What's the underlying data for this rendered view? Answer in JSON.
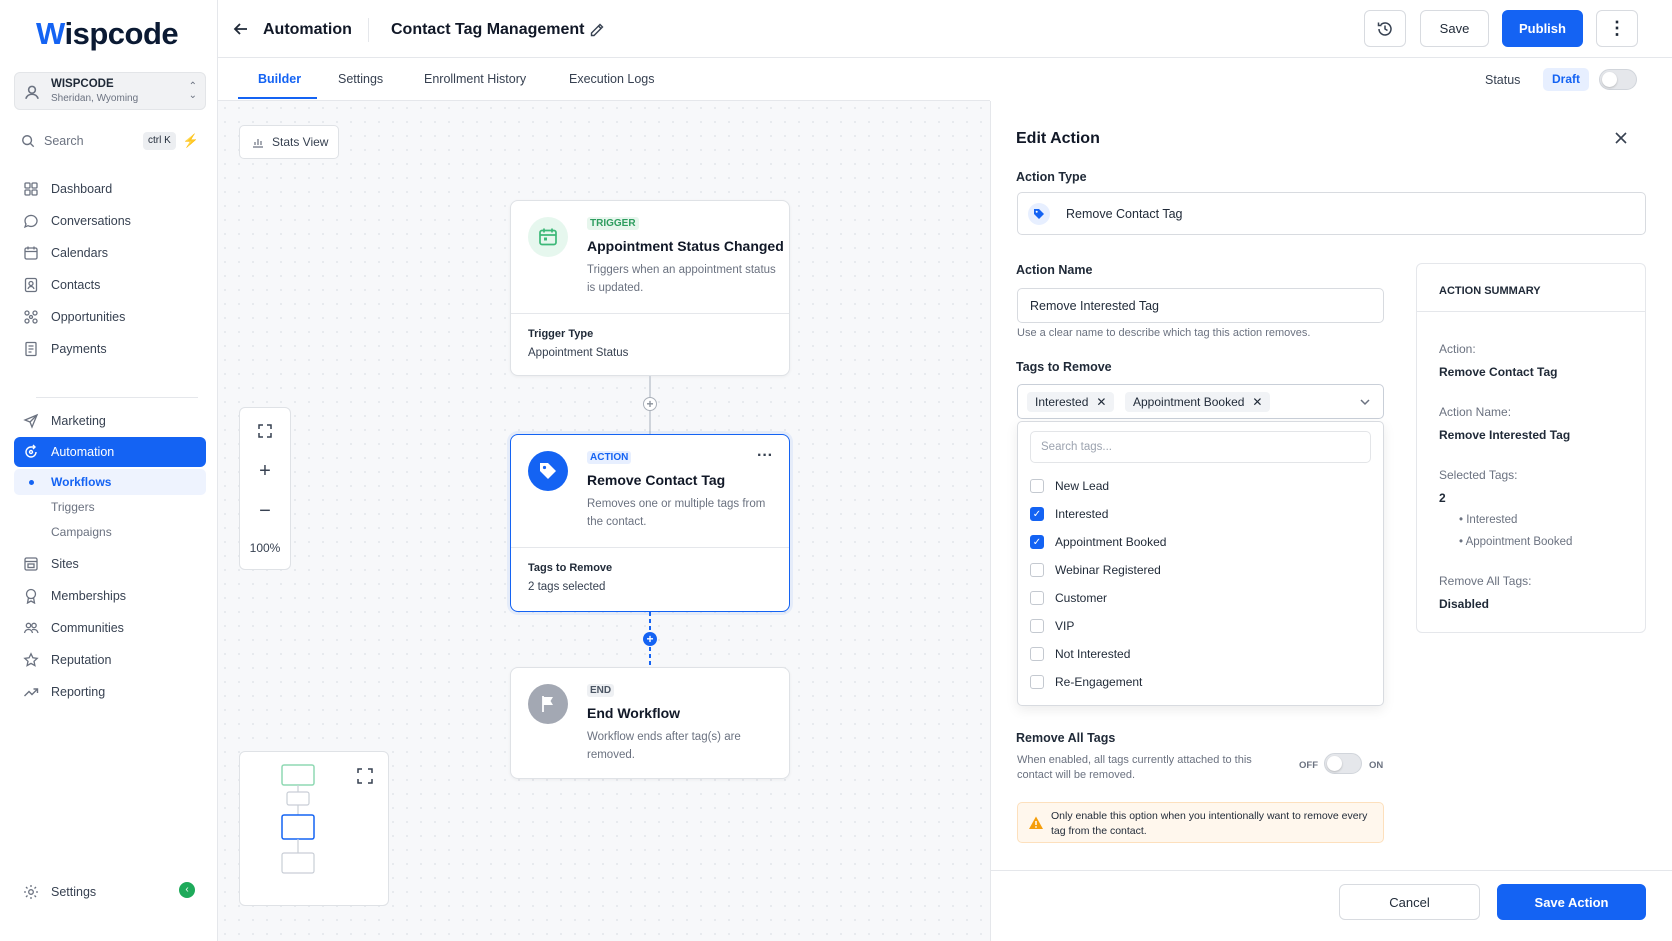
{
  "brand": {
    "logo_w": "W",
    "logo_rest": "ispcode"
  },
  "account": {
    "name": "WISPCODE",
    "location": "Sheridan, Wyoming"
  },
  "search": {
    "label": "Search",
    "shortcut": "ctrl K"
  },
  "sidebar": {
    "items": [
      {
        "label": "Dashboard",
        "icon": "grid-icon"
      },
      {
        "label": "Conversations",
        "icon": "chat-icon"
      },
      {
        "label": "Calendars",
        "icon": "calendar-icon"
      },
      {
        "label": "Contacts",
        "icon": "contacts-icon"
      },
      {
        "label": "Opportunities",
        "icon": "opportunities-icon"
      },
      {
        "label": "Payments",
        "icon": "payments-icon"
      },
      {
        "label": "Marketing",
        "icon": "send-icon"
      },
      {
        "label": "Automation",
        "icon": "automation-icon"
      },
      {
        "label": "Sites",
        "icon": "sites-icon"
      },
      {
        "label": "Memberships",
        "icon": "membership-icon"
      },
      {
        "label": "Communities",
        "icon": "communities-icon"
      },
      {
        "label": "Reputation",
        "icon": "star-icon"
      },
      {
        "label": "Reporting",
        "icon": "trend-icon"
      }
    ],
    "sub_items": [
      "Workflows",
      "Triggers",
      "Campaigns"
    ],
    "settings": "Settings"
  },
  "header": {
    "crumb": "Automation",
    "workflow_title": "Contact Tag Management",
    "save": "Save",
    "publish": "Publish"
  },
  "tabs": [
    "Builder",
    "Settings",
    "Enrollment History",
    "Execution Logs"
  ],
  "status": {
    "label": "Status",
    "value": "Draft"
  },
  "canvas": {
    "stats_view": "Stats View",
    "zoom": "100%",
    "trigger": {
      "tag": "TRIGGER",
      "title": "Appointment Status Changed",
      "desc": "Triggers when an appointment status is updated.",
      "foot_label": "Trigger Type",
      "foot_value": "Appointment Status"
    },
    "action": {
      "tag": "ACTION",
      "title": "Remove Contact Tag",
      "desc": "Removes one or multiple tags from the contact.",
      "foot_label": "Tags to Remove",
      "foot_value": "2 tags selected"
    },
    "end": {
      "tag": "END",
      "title": "End Workflow",
      "desc": "Workflow ends after tag(s) are removed."
    }
  },
  "panel": {
    "title": "Edit Action",
    "action_type_label": "Action Type",
    "action_type_value": "Remove Contact Tag",
    "action_name_label": "Action Name",
    "action_name_value": "Remove Interested Tag",
    "action_name_hint": "Use a clear name to describe which tag this action removes.",
    "tags_label": "Tags to Remove",
    "selected_chips": [
      "Interested",
      "Appointment Booked"
    ],
    "tag_search_placeholder": "Search tags...",
    "tag_options": [
      {
        "label": "New Lead",
        "checked": false
      },
      {
        "label": "Interested",
        "checked": true
      },
      {
        "label": "Appointment Booked",
        "checked": true
      },
      {
        "label": "Webinar Registered",
        "checked": false
      },
      {
        "label": "Customer",
        "checked": false
      },
      {
        "label": "VIP",
        "checked": false
      },
      {
        "label": "Not Interested",
        "checked": false
      },
      {
        "label": "Re-Engagement",
        "checked": false
      }
    ],
    "remove_all_label": "Remove All Tags",
    "remove_all_hint": "When enabled, all tags currently attached to this contact will be removed.",
    "off": "OFF",
    "on": "ON",
    "warning": "Only enable this option when you intentionally want to remove every tag from the contact.",
    "cancel": "Cancel",
    "save_action": "Save Action"
  },
  "summary": {
    "heading": "ACTION SUMMARY",
    "action_k": "Action:",
    "action_v": "Remove Contact Tag",
    "name_k": "Action Name:",
    "name_v": "Remove Interested Tag",
    "tags_k": "Selected Tags:",
    "tags_count": "2",
    "tags_list": [
      "Interested",
      "Appointment Booked"
    ],
    "remove_all_k": "Remove All Tags:",
    "remove_all_v": "Disabled"
  },
  "colors": {
    "accent": "#1463f3",
    "success": "#1eaa5a",
    "trigger_green": "#5ccf8f",
    "end_gray": "#a3a8b3"
  }
}
